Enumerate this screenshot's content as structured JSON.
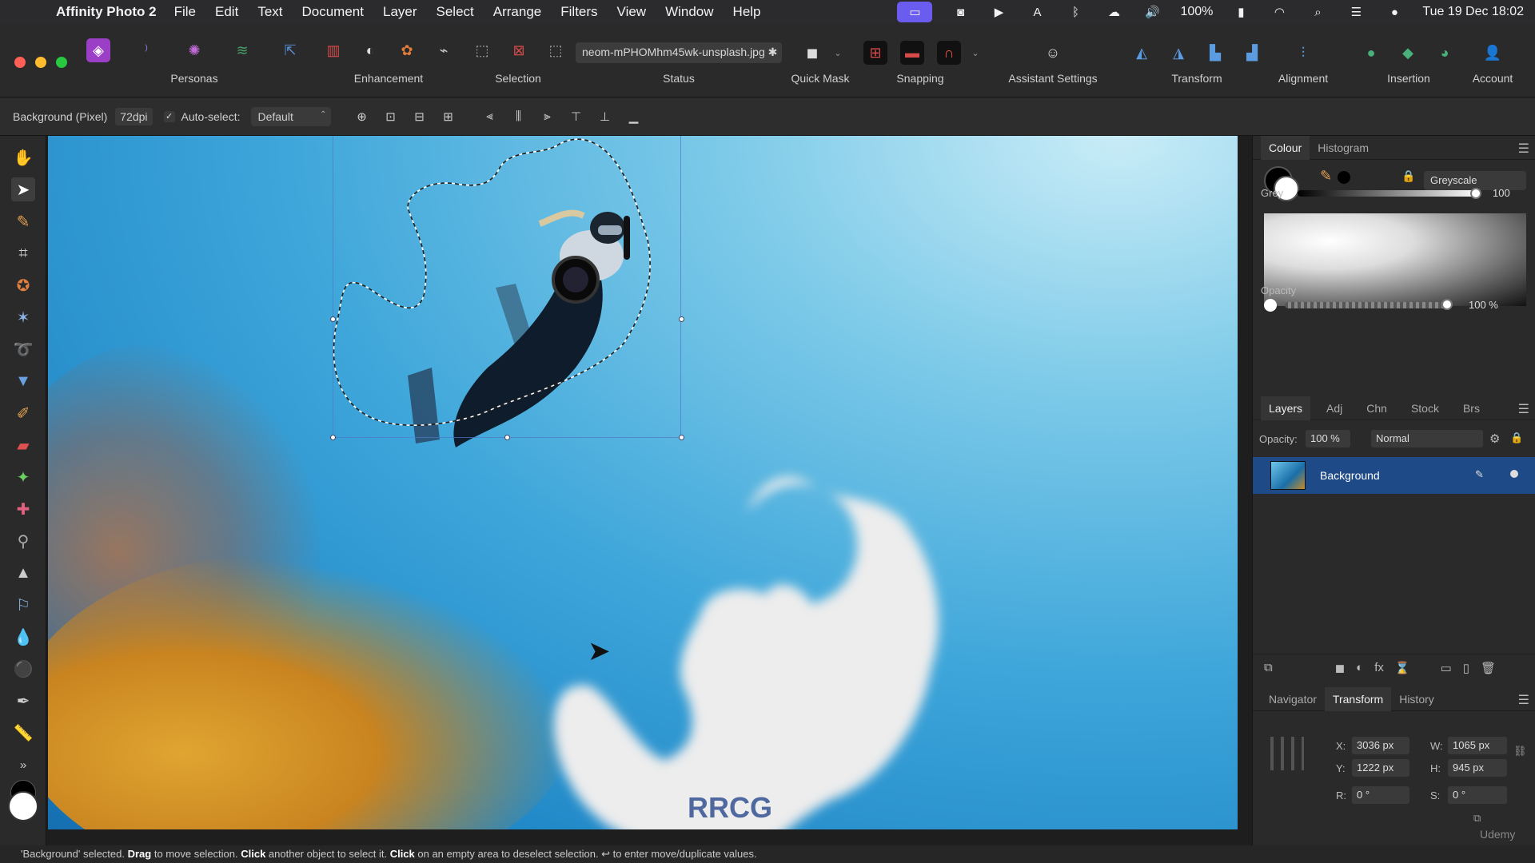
{
  "menubar": {
    "app_name": "Affinity Photo 2",
    "items": [
      "File",
      "Edit",
      "Text",
      "Document",
      "Layer",
      "Select",
      "Arrange",
      "Filters",
      "View",
      "Window",
      "Help"
    ],
    "battery": "100%",
    "clock": "Tue 19 Dec 18:02"
  },
  "toolbar": {
    "personas_label": "Personas",
    "enhancement_label": "Enhancement",
    "selection_label": "Selection",
    "status_label": "Status",
    "quickmask_label": "Quick Mask",
    "snapping_label": "Snapping",
    "assistant_label": "Assistant Settings",
    "transform_label": "Transform",
    "alignment_label": "Alignment",
    "insertion_label": "Insertion",
    "account_label": "Account",
    "filename": "neom-mPHOMhm45wk-unsplash.jpg ✱"
  },
  "context": {
    "layer_info": "Background (Pixel)",
    "dpi": "72dpi",
    "autoselect_label": "Auto-select:",
    "autoselect_value": "Default"
  },
  "colour_panel": {
    "tabs": [
      "Colour",
      "Histogram"
    ],
    "mode": "Greyscale",
    "grey_label": "Grey",
    "grey_value": "100",
    "opacity_label": "Opacity",
    "opacity_value": "100 %"
  },
  "layers_panel": {
    "tabs": [
      "Layers",
      "Adj",
      "Chn",
      "Stock",
      "Brs"
    ],
    "opacity_label": "Opacity:",
    "opacity_value": "100 %",
    "blend_mode": "Normal",
    "layers": [
      {
        "name": "Background"
      }
    ]
  },
  "transform_panel": {
    "tabs": [
      "Navigator",
      "Transform",
      "History"
    ],
    "x_label": "X:",
    "x_value": "3036 px",
    "y_label": "Y:",
    "y_value": "1222 px",
    "w_label": "W:",
    "w_value": "1065 px",
    "h_label": "H:",
    "h_value": "945 px",
    "r_label": "R:",
    "r_value": "0 °",
    "s_label": "S:",
    "s_value": "0 °"
  },
  "status_bar": {
    "part1": "'Background' selected. ",
    "drag": "Drag",
    "part2": " to move selection. ",
    "click1": "Click",
    "part3": " another object to select it. ",
    "click2": "Click",
    "part4": " on an empty area to deselect selection. ↩ to enter move/duplicate values."
  },
  "watermark": "RRCG",
  "udemy": "Udemy"
}
